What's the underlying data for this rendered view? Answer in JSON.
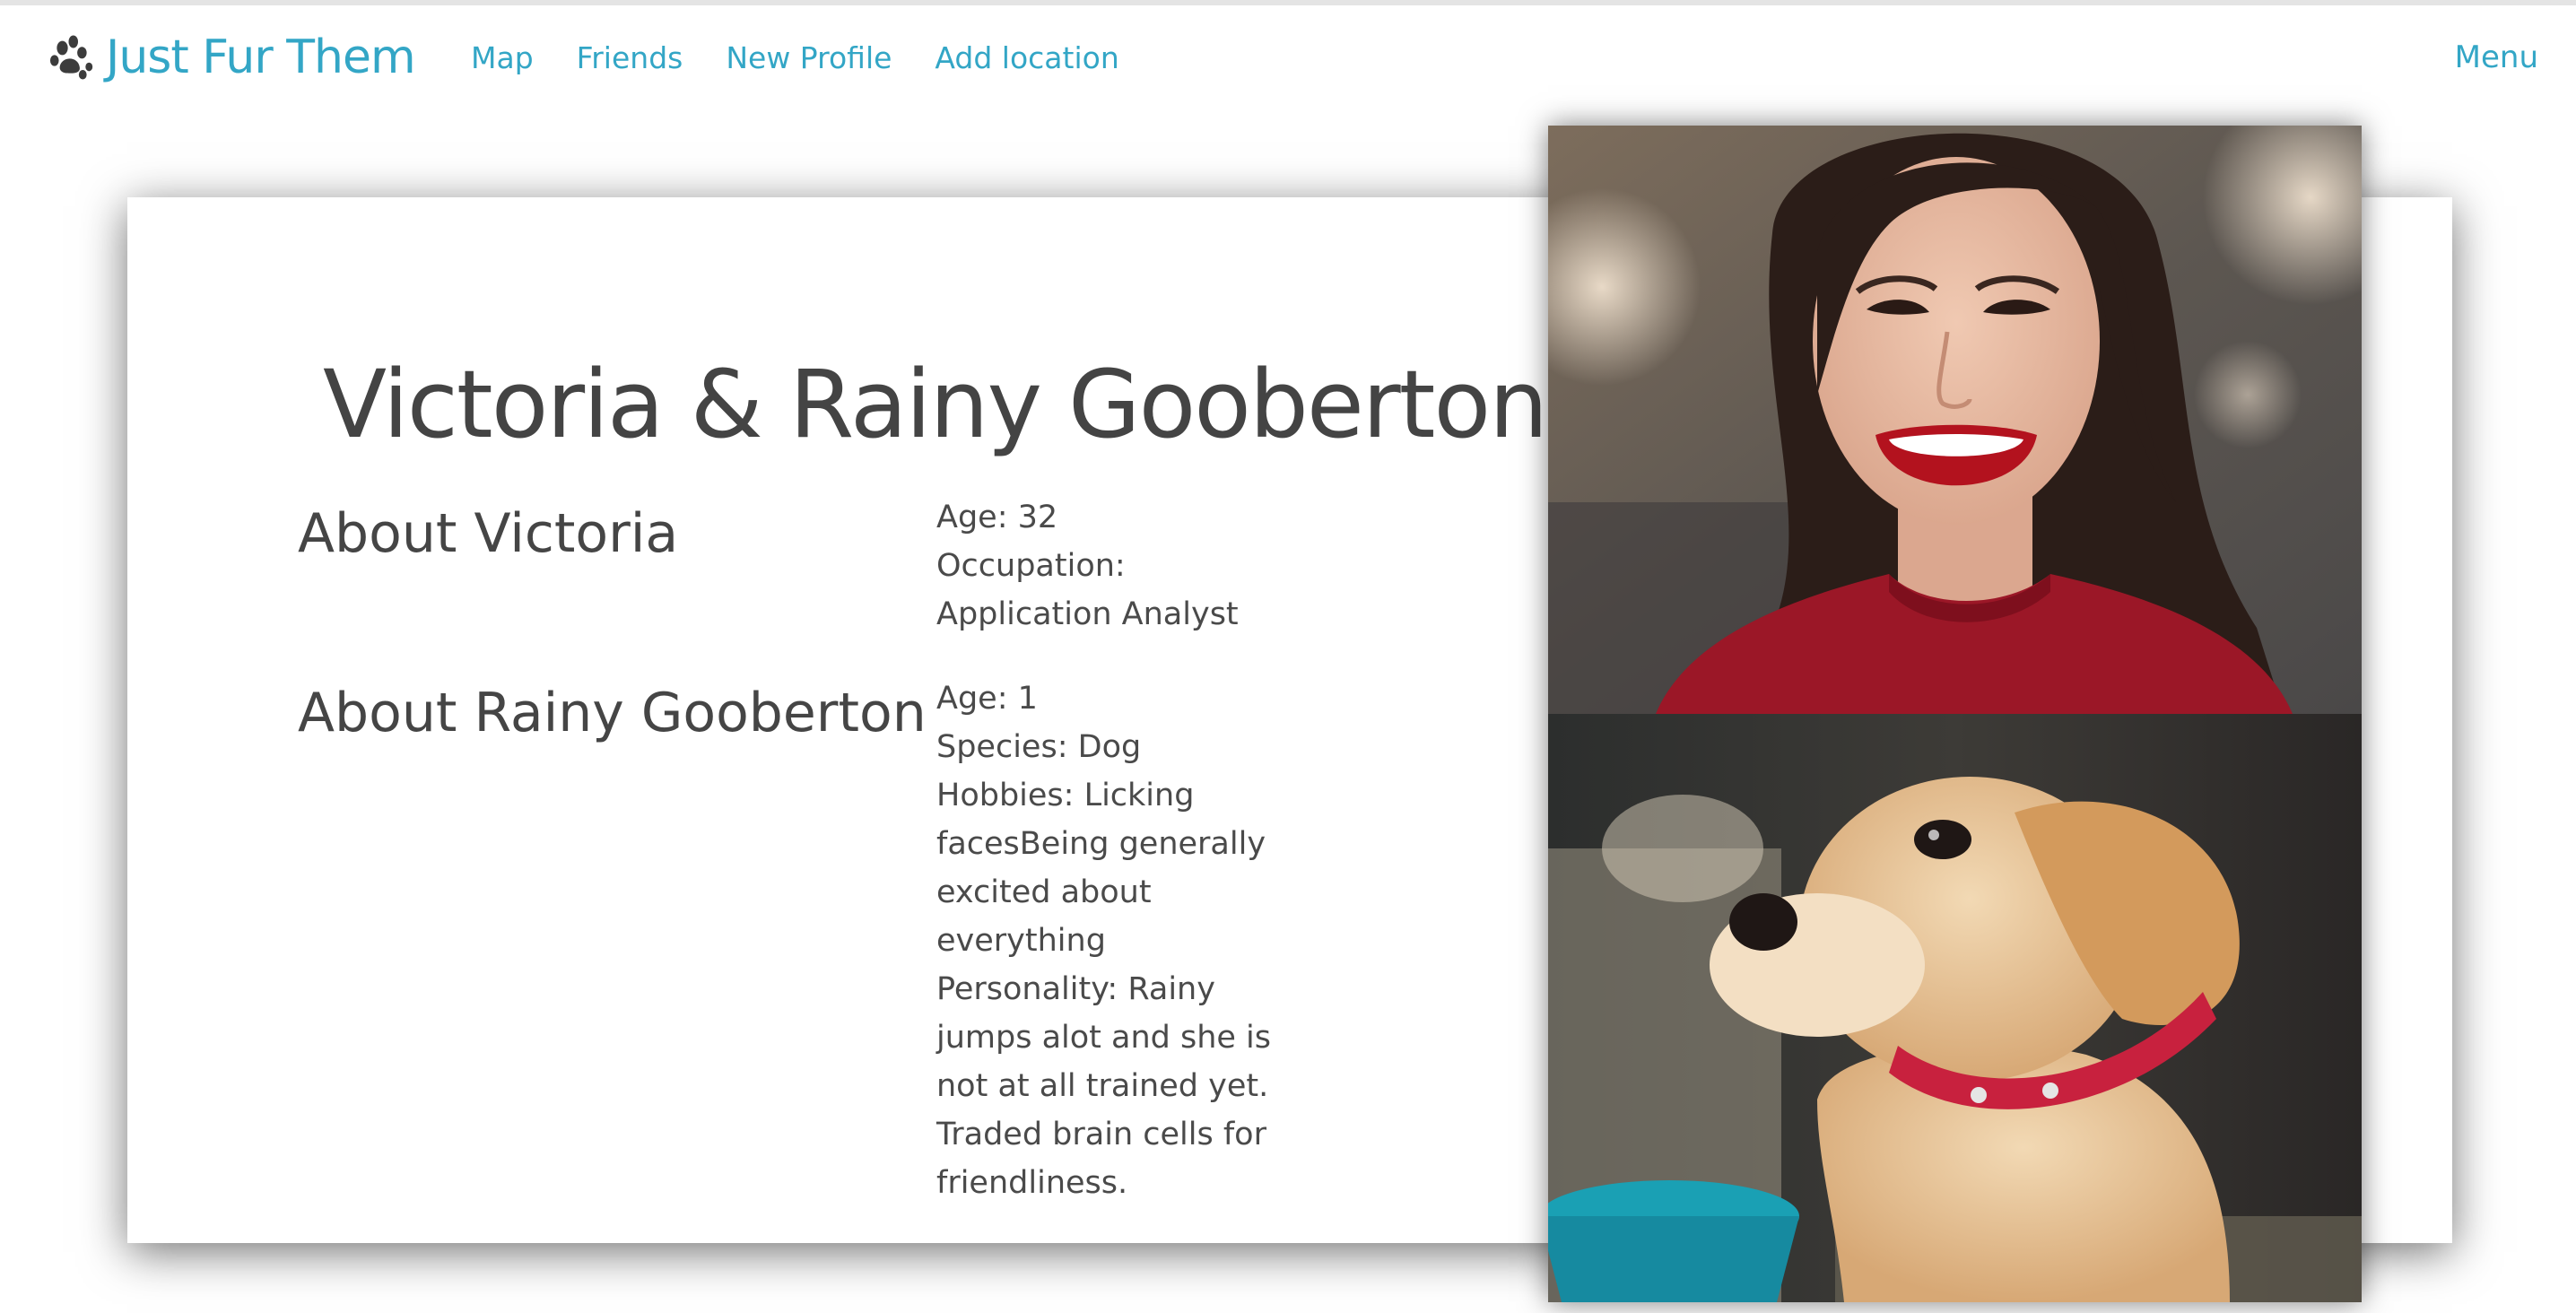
{
  "navbar": {
    "brand": "Just Fur Them",
    "links": [
      "Map",
      "Friends",
      "New Profile",
      "Add location"
    ],
    "menu": "Menu"
  },
  "profile": {
    "title": "Victoria & Rainy Gooberton",
    "human": {
      "heading": "About Victoria",
      "age": "Age: 32",
      "occupation": "Occupation: Application Analyst"
    },
    "pet": {
      "heading": "About Rainy Gooberton",
      "age": "Age: 1",
      "species": "Species: Dog",
      "hobbies": "Hobbies: Licking facesBeing generally excited about everything",
      "personality": "Personality: Rainy jumps alot and she is not at all trained yet. Traded brain cells for friendliness."
    }
  },
  "icons": {
    "brand_icon": "paw-icon"
  },
  "colors": {
    "accent": "#33a6c6",
    "text": "#444444"
  }
}
